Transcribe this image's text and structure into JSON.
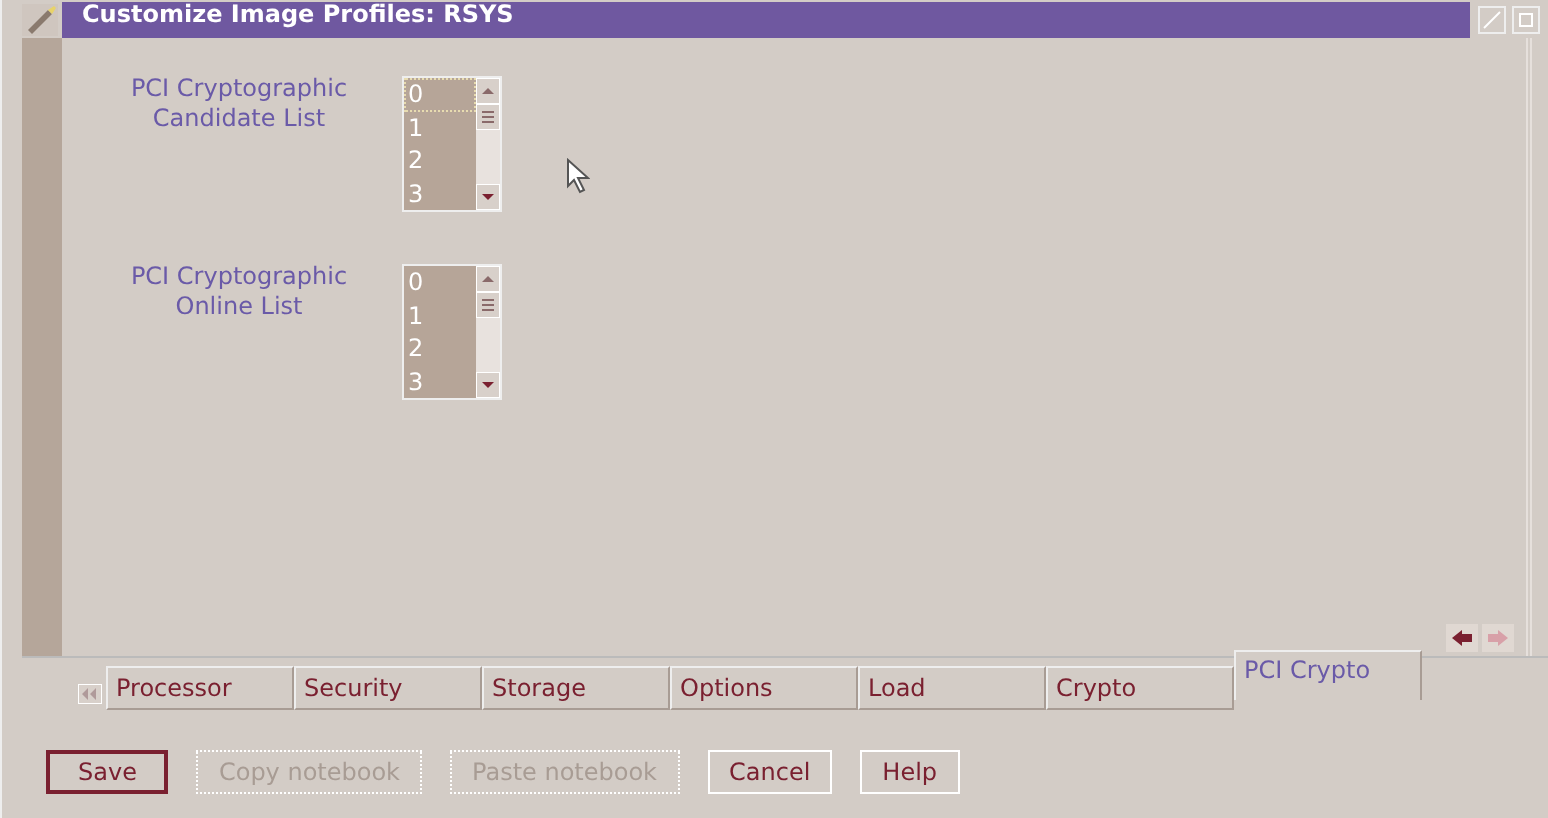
{
  "window": {
    "title": "Customize Image Profiles: RSYS"
  },
  "lists": [
    {
      "label_lines": [
        "PCI Cryptographic",
        "Candidate List"
      ],
      "items": [
        {
          "text": "0",
          "focused": true
        },
        {
          "text": "1",
          "focused": false
        },
        {
          "text": "2",
          "focused": false
        },
        {
          "text": "3",
          "focused": false
        }
      ]
    },
    {
      "label_lines": [
        "PCI Cryptographic",
        "Online List"
      ],
      "items": [
        {
          "text": "0",
          "focused": false
        },
        {
          "text": "1",
          "focused": false
        },
        {
          "text": "2",
          "focused": false
        },
        {
          "text": "3",
          "focused": false
        }
      ]
    }
  ],
  "tabs": [
    {
      "label": "Processor",
      "selected": false
    },
    {
      "label": "Security",
      "selected": false
    },
    {
      "label": "Storage",
      "selected": false
    },
    {
      "label": "Options",
      "selected": false
    },
    {
      "label": "Load",
      "selected": false
    },
    {
      "label": "Crypto",
      "selected": false
    },
    {
      "label": "PCI Crypto",
      "selected": true
    }
  ],
  "buttons": [
    {
      "label": "Save",
      "disabled": false,
      "default": true
    },
    {
      "label": "Copy notebook",
      "disabled": true,
      "default": false
    },
    {
      "label": "Paste notebook",
      "disabled": true,
      "default": false
    },
    {
      "label": "Cancel",
      "disabled": false,
      "default": false
    },
    {
      "label": "Help",
      "disabled": false,
      "default": false
    }
  ]
}
